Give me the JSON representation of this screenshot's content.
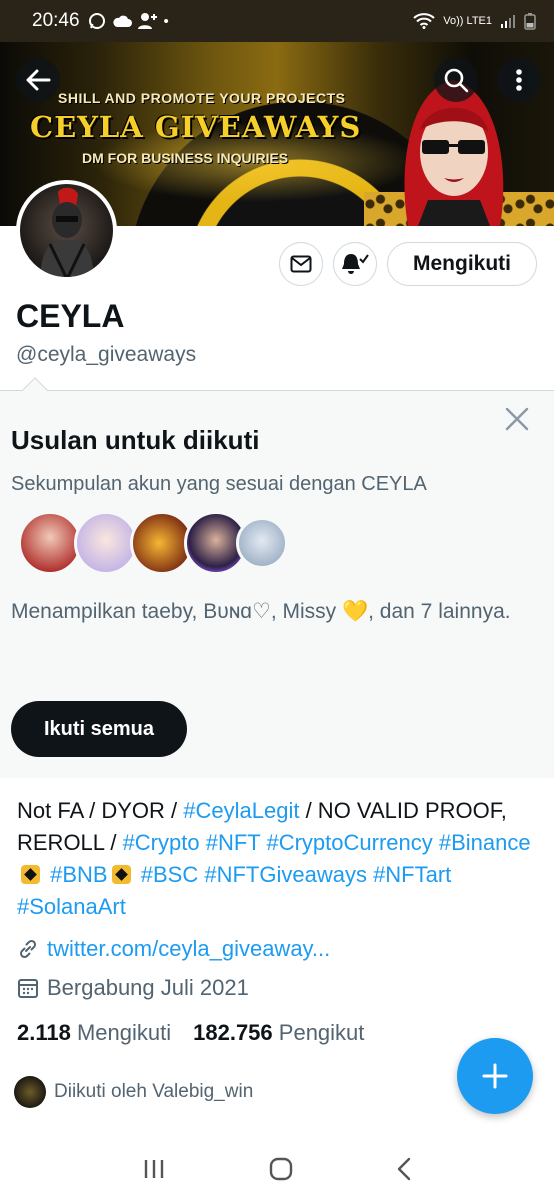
{
  "status_bar": {
    "time": "20:46",
    "network_label": "Vo)) LTE1"
  },
  "banner": {
    "line1": "SHILL AND PROMOTE YOUR PROJECTS",
    "line2": "CEYLA GIVEAWAYS",
    "line3": "DM FOR BUSINESS INQUIRIES"
  },
  "header": {
    "back_icon": "back-arrow-icon",
    "search_icon": "search-icon",
    "more_icon": "more-vertical-icon"
  },
  "profile": {
    "name": "CEYLA",
    "handle": "@ceyla_giveaways",
    "follow_label": "Mengikuti",
    "message_icon": "envelope-icon",
    "notify_icon": "bell-check-icon"
  },
  "suggestions": {
    "title": "Usulan untuk diikuti",
    "subtitle": "Sekumpulan akun yang sesuai dengan CEYLA",
    "shown_text_a": "Menampilkan taeby, Bᴜɴɑ♡, Missy ",
    "heart": "💛",
    "shown_text_b": ", dan 7 lainnya.",
    "follow_all_label": "Ikuti semua"
  },
  "bio": {
    "t1": "Not FA / DYOR / ",
    "tag_legit": "#CeylaLegit",
    "t2": " / NO VALID PROOF, REROLL / ",
    "tag_crypto": "#Crypto",
    "tag_nft": "#NFT",
    "tag_cc": "#CryptoCurrency",
    "tag_binance": "#Binance",
    "tag_bnb": "#BNB",
    "tag_bsc": "#BSC",
    "tag_nftg": "#NFTGiveaways",
    "tag_nftart": "#NFTart",
    "tag_sol": "#SolanaArt"
  },
  "meta": {
    "website": "twitter.com/ceyla_giveaway...",
    "joined": "Bergabung Juli 2021"
  },
  "stats": {
    "following_count": "2.118",
    "following_label": "Mengikuti",
    "followers_count": "182.756",
    "followers_label": "Pengikut"
  },
  "followed_by": "Diikuti oleh Valebig_win",
  "colors": {
    "accent": "#1d9bf0",
    "text": "#0f1419",
    "muted": "#536471",
    "panel": "#f7f9f9"
  }
}
